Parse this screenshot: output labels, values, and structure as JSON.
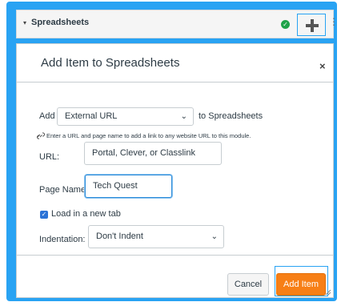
{
  "module": {
    "title": "Spreadsheets",
    "caret": "▾",
    "kebab": "⋮"
  },
  "dialog": {
    "title": "Add Item to Spreadsheets",
    "close": "×",
    "add_label": "Add",
    "item_type": "External URL",
    "to_label": "to Spreadsheets",
    "hint": "Enter a URL and page name to add a link to any website URL to this module.",
    "url_label": "URL:",
    "url_value": "Portal, Clever, or Classlink",
    "page_name_label": "Page Name:",
    "page_name_value": "Tech Quest",
    "new_tab_label": "Load in a new tab",
    "new_tab_checked": true,
    "indentation_label": "Indentation:",
    "indentation_value": "Don't Indent",
    "cancel_label": "Cancel",
    "add_item_label": "Add Item"
  },
  "colors": {
    "frame_blue": "#29a3f3",
    "publish_green": "#1fa34a",
    "primary_orange": "#f77f16",
    "checkbox_blue": "#2b73d6"
  },
  "icons": {
    "caret": "caret-down-icon",
    "published": "check-circle-icon",
    "add": "plus-icon",
    "more": "kebab-icon",
    "close": "close-icon",
    "hint": "link-icon",
    "select": "chevron-down-icon",
    "resize": "resize-handle-icon"
  }
}
